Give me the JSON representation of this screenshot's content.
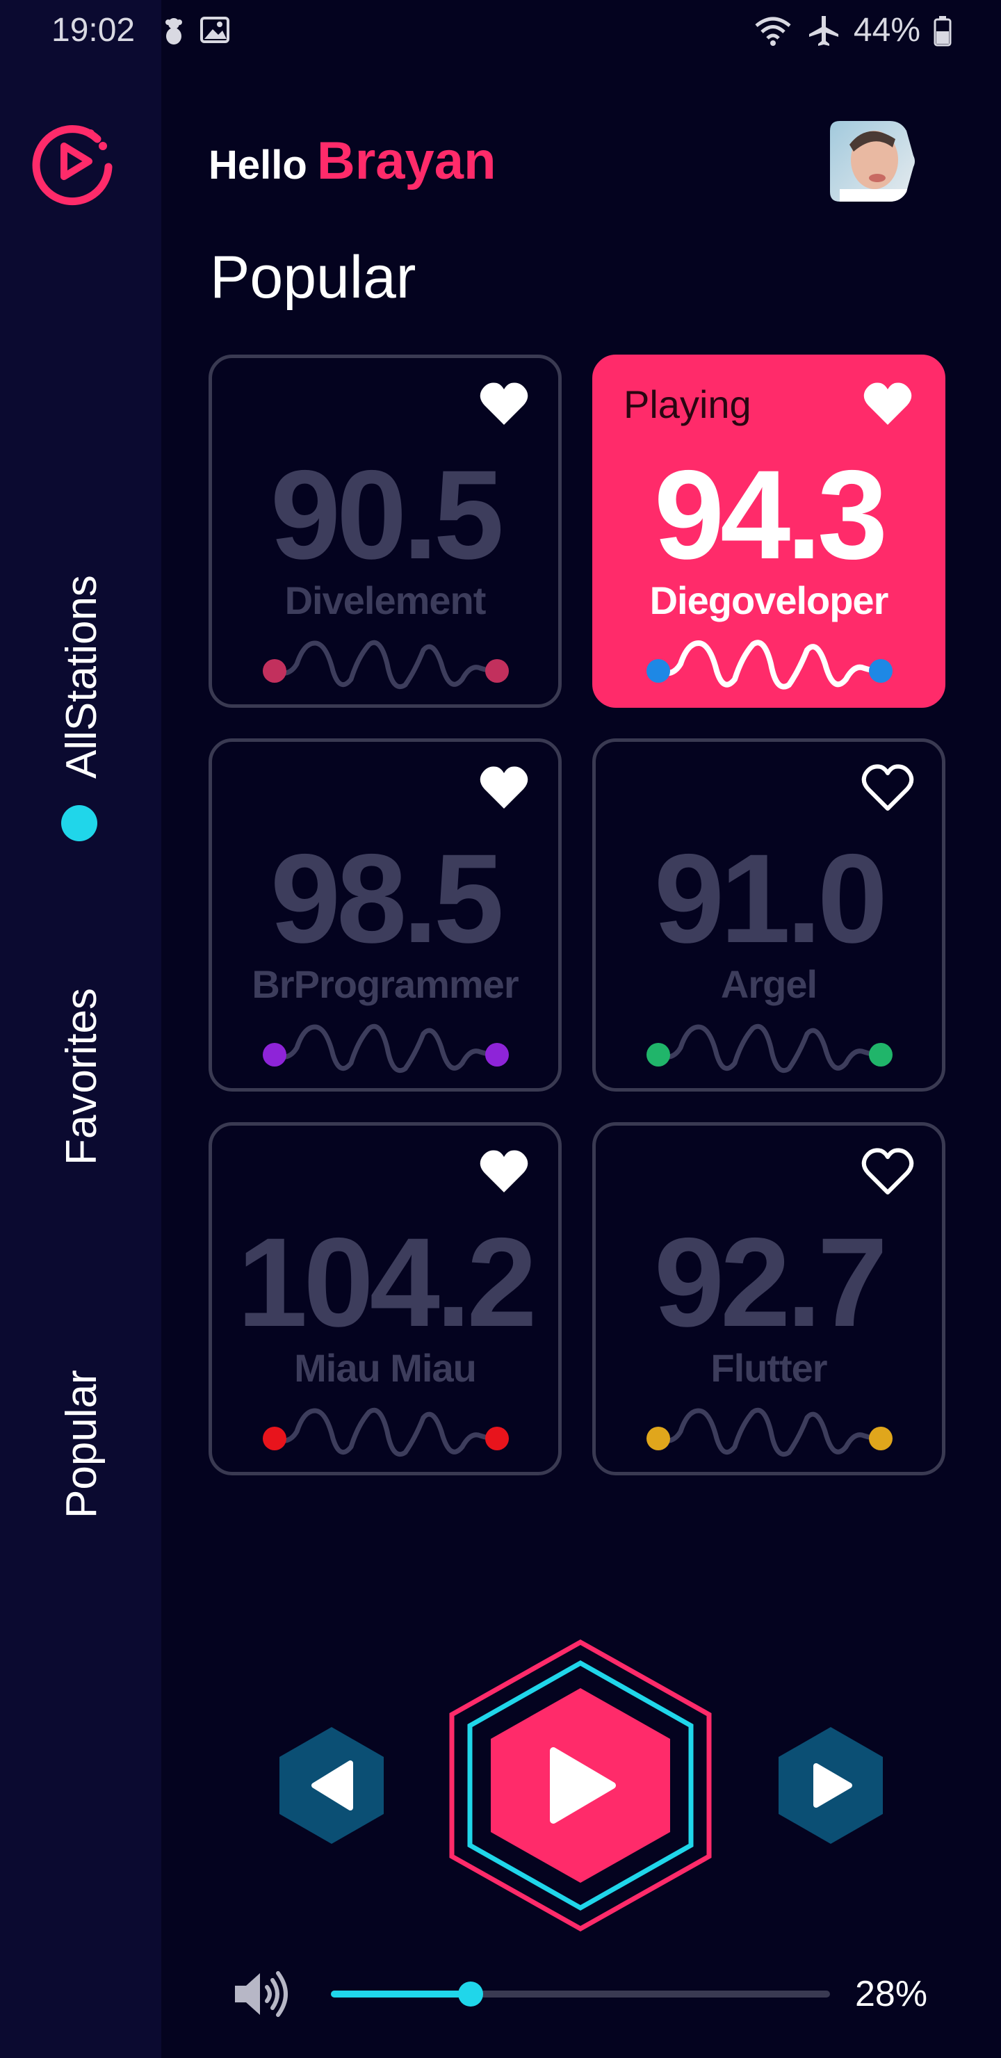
{
  "status_bar": {
    "time": "19:02",
    "left_icons": [
      "teddy-bear-icon",
      "image-icon"
    ],
    "right_icons": [
      "wifi-icon",
      "airplane-icon",
      "battery-icon"
    ],
    "battery": "44%"
  },
  "sidebar": {
    "logo_icon": "play-logo-icon",
    "items": [
      {
        "label": "AllStations",
        "active": true
      },
      {
        "label": "Favorites",
        "active": false
      },
      {
        "label": "Popular",
        "active": false
      }
    ]
  },
  "header": {
    "hello": "Hello",
    "name": "Brayan",
    "avatar": "user-avatar"
  },
  "section_title": "Popular",
  "stations": [
    {
      "freq": "90.5",
      "name": "Divelement",
      "favorite": true,
      "playing": false,
      "dot_color": "#c2305d"
    },
    {
      "freq": "94.3",
      "name": "Diegoveloper",
      "favorite": true,
      "playing": true,
      "playing_label": "Playing",
      "dot_color": "#1e88e5"
    },
    {
      "freq": "98.5",
      "name": "BrProgrammer",
      "favorite": true,
      "playing": false,
      "dot_color": "#8e24d8"
    },
    {
      "freq": "91.0",
      "name": "Argel",
      "favorite": false,
      "playing": false,
      "dot_color": "#20b56a"
    },
    {
      "freq": "104.2",
      "name": "Miau Miau",
      "favorite": true,
      "playing": false,
      "dot_color": "#e8141c"
    },
    {
      "freq": "92.7",
      "name": "Flutter",
      "favorite": false,
      "playing": false,
      "dot_color": "#e0a61c"
    }
  ],
  "player": {
    "prev_icon": "previous-icon",
    "play_icon": "play-icon",
    "next_icon": "next-icon",
    "volume_icon": "volume-icon",
    "volume_percent": "28%",
    "volume_level": 0.28
  },
  "colors": {
    "background": "#04031f",
    "sidebar": "#0b0a30",
    "accent": "#ff2b6a",
    "cyan": "#20d6ea",
    "muted": "#3d3d5c",
    "hex_button": "#0b4f74"
  }
}
